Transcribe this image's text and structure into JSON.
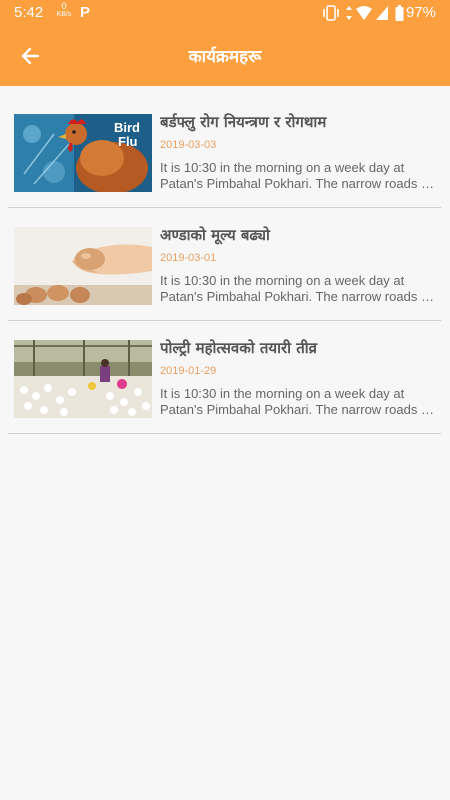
{
  "status_bar": {
    "time": "5:42",
    "net_speed_value": "0",
    "net_speed_unit": "KB/s",
    "notif_letter": "P",
    "battery": "97%",
    "icons": [
      "vibrate-icon",
      "data-arrows-icon",
      "wifi-icon",
      "signal-icon",
      "battery-icon"
    ]
  },
  "app_bar": {
    "title": "कार्यक्रमहरू",
    "back_icon": "arrow-left-icon",
    "background_color": "#fca03f"
  },
  "items": [
    {
      "title": "बर्डफ्लु रोग नियन्त्रण र रोगथाम",
      "date": "2019-03-03",
      "desc_line1": "It is 10:30 in the morning on a week day at",
      "desc_line2": "Patan's Pimbahal Pokhari. The narrow roads s...",
      "image_text_line1": "Bird",
      "image_text_line2": "Flu"
    },
    {
      "title": "अण्डाको मूल्य बढ्यो",
      "date": "2019-03-01",
      "desc_line1": "It is 10:30 in the morning on a week day at",
      "desc_line2": "Patan's Pimbahal Pokhari. The narrow roads s..."
    },
    {
      "title": "पोल्ट्री महोत्सवको तयारी तीव्र",
      "date": "2019-01-29",
      "desc_line1": "It is 10:30 in the morning on a week day at",
      "desc_line2": "Patan's Pimbahal Pokhari. The narrow roads s..."
    }
  ]
}
